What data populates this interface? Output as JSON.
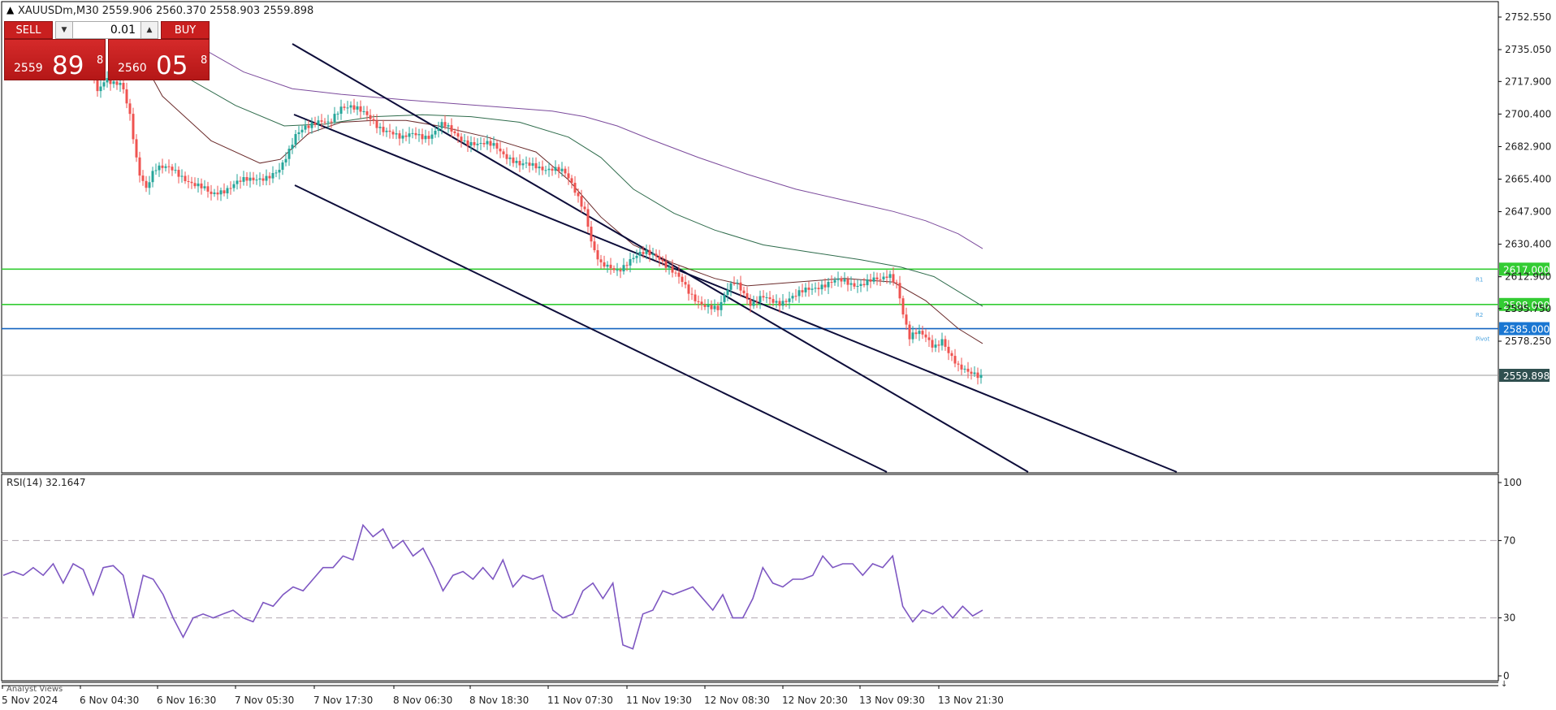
{
  "chart_header": {
    "symbol_info": "XAUUSDm,M30  2559.906 2560.370 2558.903 2559.898",
    "indicator_label": "RSI(14) 32.1647",
    "bottom_tab": "Analyst Views"
  },
  "trade_panel": {
    "sell_label": "SELL",
    "buy_label": "BUY",
    "lot_value": "0.01",
    "sell_price_prefix": "2559",
    "sell_price_big": "89",
    "sell_price_sup": "8",
    "buy_price_prefix": "2560",
    "buy_price_big": "05",
    "buy_price_sup": "8"
  },
  "colors": {
    "bull_candle": "#26a69a",
    "bear_candle": "#ef5350",
    "channel_lines": "#0d0d3a",
    "support_resistance": "#33cc33",
    "pivot_line": "#1565c0",
    "ma_fast": "#6b2b2b",
    "ma_mid": "#2e6b4b",
    "ma_slow": "#7b4a9c",
    "rsi_line": "#7e57c2",
    "current_price_label_bg": "#2f4f4f"
  },
  "chart_data": {
    "type": "line",
    "title": "XAUUSDm,M30",
    "series": [
      {
        "name": "RSI(14)",
        "values": [
          52,
          54,
          52,
          56,
          52,
          58,
          48,
          58,
          55,
          42,
          56,
          57,
          52,
          30,
          52,
          50,
          42,
          30,
          20,
          30,
          32,
          30,
          32,
          34,
          30,
          28,
          38,
          36,
          42,
          46,
          44,
          50,
          56,
          56,
          62,
          60,
          78,
          72,
          76,
          66,
          70,
          62,
          66,
          56,
          44,
          52,
          54,
          50,
          56,
          50,
          60,
          46,
          52,
          50,
          52,
          34,
          30,
          32,
          44,
          48,
          40,
          48,
          16,
          14,
          32,
          34,
          44,
          42,
          44,
          46,
          40,
          34,
          42,
          30,
          30,
          40,
          56,
          48,
          46,
          50,
          50,
          52,
          62,
          56,
          58,
          58,
          52,
          58,
          56,
          62,
          36,
          28,
          34,
          32,
          36,
          30,
          36,
          31,
          34
        ]
      }
    ],
    "x_tick_labels": [
      "5 Nov 2024",
      "6 Nov 04:30",
      "6 Nov 16:30",
      "7 Nov 05:30",
      "7 Nov 17:30",
      "8 Nov 06:30",
      "8 Nov 18:30",
      "11 Nov 07:30",
      "11 Nov 19:30",
      "12 Nov 08:30",
      "12 Nov 20:30",
      "13 Nov 09:30",
      "13 Nov 21:30"
    ],
    "price_axis_labels": [
      "2752.550",
      "2735.050",
      "2717.900",
      "2700.400",
      "2682.900",
      "2665.400",
      "2647.900",
      "2630.400",
      "2612.900",
      "2595.750",
      "2578.250"
    ],
    "price_range": [
      2558,
      2756
    ],
    "horizontal_levels": [
      {
        "price": 2617.0,
        "label": "2617.000",
        "tag": "R1"
      },
      {
        "price": 2598.0,
        "label": "2598.000",
        "tag": "R2"
      },
      {
        "price": 2585.0,
        "label": "2585.000",
        "tag": "Pivot"
      },
      {
        "price": 2559.898,
        "label": "2559.898",
        "tag": ""
      }
    ],
    "rsi_axis_labels": [
      "100",
      "70",
      "30",
      "0"
    ],
    "rsi_range": [
      0,
      100
    ],
    "rsi_levels": [
      70,
      30
    ]
  }
}
